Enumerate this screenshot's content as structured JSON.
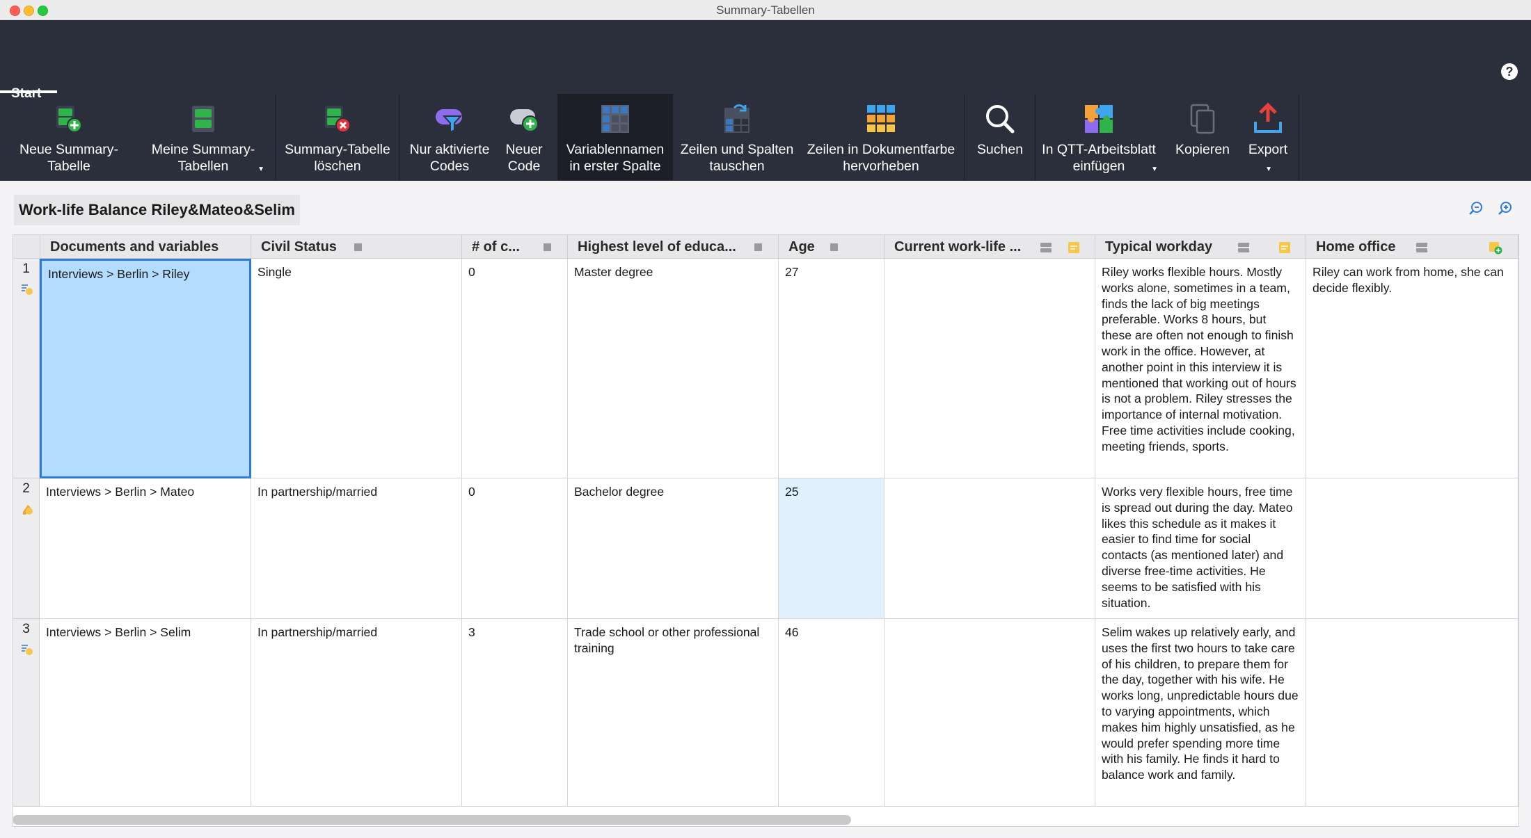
{
  "window": {
    "title": "Summary-Tabellen"
  },
  "ribbon": {
    "tab": "Start",
    "help": "?",
    "tools": [
      {
        "line1": "Neue Summary-",
        "line2": "Tabelle",
        "icon": "new-summary-table-icon"
      },
      {
        "line1": "Meine Summary-",
        "line2": "Tabellen",
        "icon": "my-summary-tables-icon"
      },
      {
        "line1": "Summary-Tabelle",
        "line2": "löschen",
        "icon": "delete-summary-table-icon"
      },
      {
        "line1": "Nur aktivierte",
        "line2": "Codes",
        "icon": "filter-codes-icon"
      },
      {
        "line1": "Neuer",
        "line2": "Code",
        "icon": "new-code-icon"
      },
      {
        "line1": "Variablennamen",
        "line2": "in erster Spalte",
        "icon": "grid-icon"
      },
      {
        "line1": "Zeilen und Spalten",
        "line2": "tauschen",
        "icon": "swap-rows-columns-icon"
      },
      {
        "line1": "Zeilen in Dokumentfarbe",
        "line2": "hervorheben",
        "icon": "color-grid-icon"
      },
      {
        "line1": "Suchen",
        "line2": "",
        "icon": "search-icon"
      },
      {
        "line1": "In QTT-Arbeitsblatt",
        "line2": "einfügen",
        "icon": "puzzle-icon"
      },
      {
        "line1": "Kopieren",
        "line2": "",
        "icon": "copy-icon"
      },
      {
        "line1": "Export",
        "line2": "",
        "icon": "export-icon"
      }
    ]
  },
  "table_title": "Work-life Balance Riley&Mateo&Selim",
  "columns": [
    "Documents and variables",
    "Civil Status",
    "# of c...",
    "Highest level of educa...",
    "Age",
    "Current work-life ...",
    "Typical workday",
    "Home office"
  ],
  "rows": [
    {
      "num": "1",
      "document": "Interviews > Berlin > Riley",
      "civil_status": "Single",
      "children": "0",
      "education": "Master degree",
      "age": "27",
      "current": "",
      "workday": "Riley works flexible hours. Mostly works alone, sometimes in a team, finds the lack of big meetings preferable. Works 8 hours, but these are often not enough to finish work in the office. However, at another point in this interview it is mentioned that working out of hours is not a problem. Riley stresses the importance of internal motivation. Free time activities include cooking, meeting friends, sports.",
      "home_office": "Riley can work from home, she can decide flexibly."
    },
    {
      "num": "2",
      "document": "Interviews > Berlin > Mateo",
      "civil_status": "In partnership/married",
      "children": "0",
      "education": "Bachelor degree",
      "age": "25",
      "current": "",
      "workday": "Works very flexible hours, free time is spread out during the day. Mateo likes this schedule as it makes it easier to find time for social contacts (as mentioned later) and diverse free-time activities. He seems to be satisfied with his situation.",
      "home_office": ""
    },
    {
      "num": "3",
      "document": "Interviews > Berlin > Selim",
      "civil_status": "In partnership/married",
      "children": "3",
      "education": "Trade school or other professional training",
      "age": "46",
      "current": "",
      "workday": "Selim wakes up relatively early, and uses the first two hours to take care of his children, to prepare them for the day, together with his wife. He works long, unpredictable hours due to varying appointments, which makes him highly unsatisfied, as he would prefer spending more time with his family. He finds it hard to balance work and family.",
      "home_office": ""
    }
  ]
}
